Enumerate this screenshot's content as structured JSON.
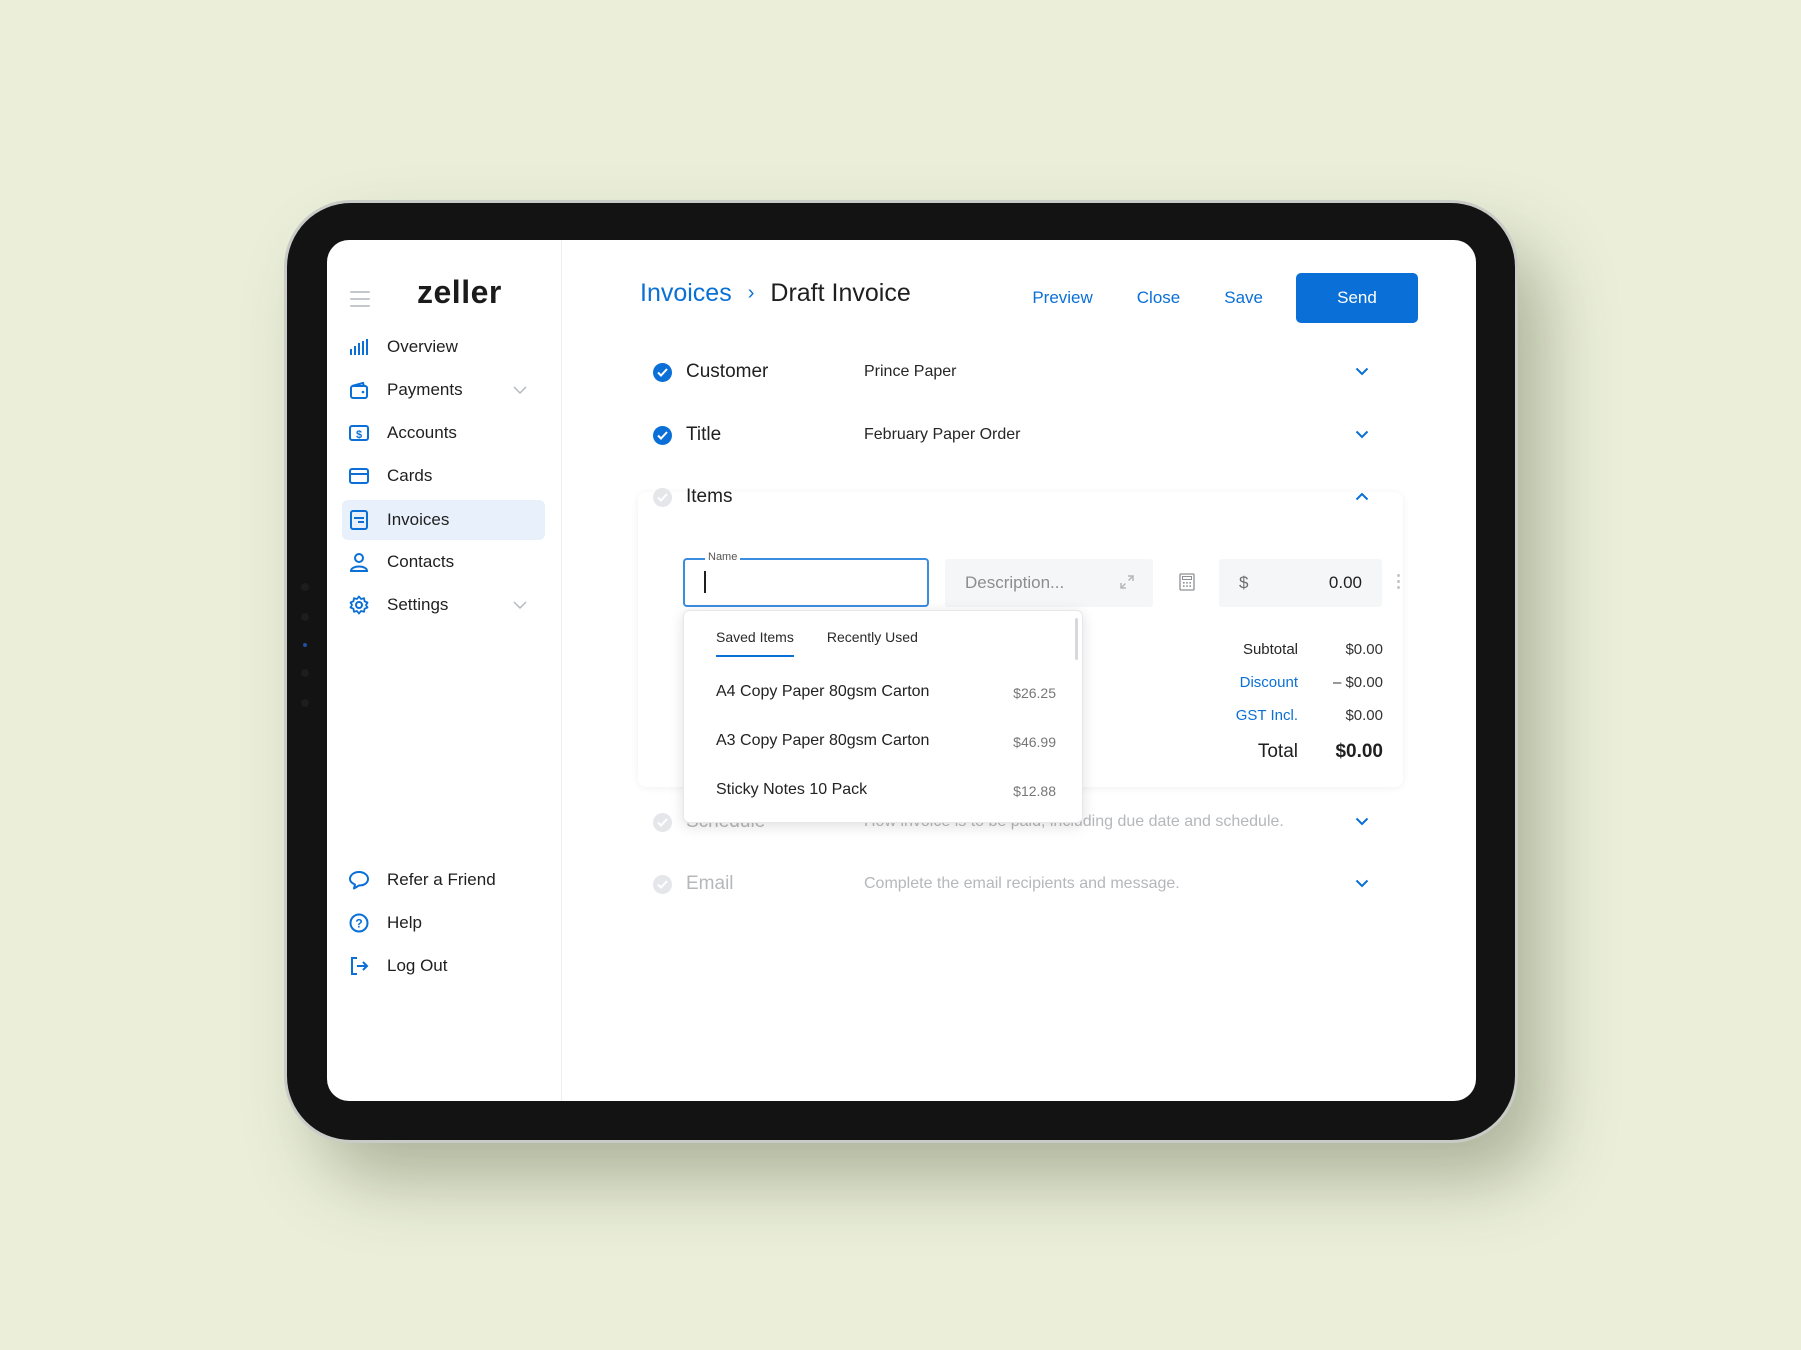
{
  "app": {
    "logo": "zeller"
  },
  "sidebar": {
    "items": [
      {
        "label": "Overview",
        "icon": "bar-chart-icon",
        "expandable": false,
        "active": false
      },
      {
        "label": "Payments",
        "icon": "wallet-icon",
        "expandable": true,
        "active": false
      },
      {
        "label": "Accounts",
        "icon": "dollar-account-icon",
        "expandable": false,
        "active": false
      },
      {
        "label": "Cards",
        "icon": "credit-card-icon",
        "expandable": false,
        "active": false
      },
      {
        "label": "Invoices",
        "icon": "invoice-icon",
        "expandable": false,
        "active": true
      },
      {
        "label": "Contacts",
        "icon": "person-icon",
        "expandable": false,
        "active": false
      },
      {
        "label": "Settings",
        "icon": "gear-icon",
        "expandable": true,
        "active": false
      }
    ],
    "footer": [
      {
        "label": "Refer a Friend",
        "icon": "speech-bubble-icon"
      },
      {
        "label": "Help",
        "icon": "question-circle-icon"
      },
      {
        "label": "Log Out",
        "icon": "logout-icon"
      }
    ]
  },
  "header": {
    "breadcrumb_parent": "Invoices",
    "breadcrumb_sep": "›",
    "page_title": "Draft Invoice",
    "actions": {
      "preview": "Preview",
      "close": "Close",
      "save": "Save",
      "send": "Send"
    }
  },
  "sections": {
    "customer": {
      "label": "Customer",
      "value": "Prince Paper",
      "complete": true
    },
    "title": {
      "label": "Title",
      "value": "February Paper Order",
      "complete": true
    },
    "items": {
      "label": "Items",
      "complete": false,
      "expanded": true
    },
    "schedule": {
      "label": "Schedule",
      "value": "How invoice is to be paid, including due date and schedule.",
      "complete": false
    },
    "email": {
      "label": "Email",
      "value": "Complete the email recipients and message.",
      "complete": false
    }
  },
  "item_line": {
    "name_label": "Name",
    "name_value": "",
    "description_placeholder": "Description...",
    "currency": "$",
    "price": "0.00"
  },
  "item_picker": {
    "tabs": [
      "Saved Items",
      "Recently Used"
    ],
    "active_tab": "Saved Items",
    "items": [
      {
        "name": "A4 Copy Paper 80gsm Carton",
        "price": "$26.25"
      },
      {
        "name": "A3 Copy Paper 80gsm Carton",
        "price": "$46.99"
      },
      {
        "name": "Sticky Notes 10 Pack",
        "price": "$12.88"
      }
    ]
  },
  "totals": {
    "subtotal_label": "Subtotal",
    "subtotal": "$0.00",
    "discount_label": "Discount",
    "discount": "– $0.00",
    "gst_label": "GST Incl.",
    "gst": "$0.00",
    "total_label": "Total",
    "total": "$0.00"
  },
  "colors": {
    "accent": "#0a6fd6",
    "background": "#ebefda",
    "active_nav": "#e8f1fb"
  }
}
